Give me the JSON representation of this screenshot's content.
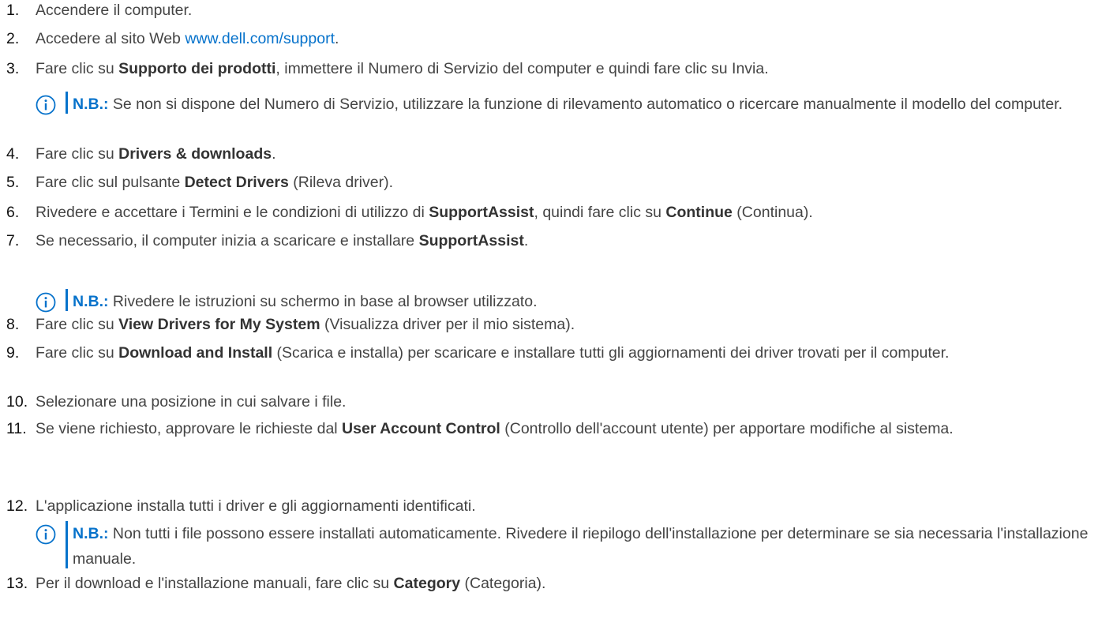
{
  "steps": [
    {
      "num": "1.",
      "parts": [
        {
          "t": "Accendere il computer."
        }
      ]
    },
    {
      "num": "2.",
      "parts": [
        {
          "t": "Accedere al sito Web "
        },
        {
          "t": "www.dell.com/support",
          "link": true
        },
        {
          "t": "."
        }
      ]
    },
    {
      "num": "3.",
      "parts": [
        {
          "t": "Fare clic su "
        },
        {
          "t": "Supporto dei prodotti",
          "b": true
        },
        {
          "t": ", immettere il Numero di Servizio del computer e quindi fare clic su Invia."
        }
      ]
    },
    {
      "num": "4.",
      "parts": [
        {
          "t": "Fare clic su "
        },
        {
          "t": "Drivers & downloads",
          "b": true
        },
        {
          "t": "."
        }
      ]
    },
    {
      "num": "5.",
      "parts": [
        {
          "t": "Fare clic sul pulsante "
        },
        {
          "t": "Detect Drivers",
          "b": true
        },
        {
          "t": " (Rileva driver)."
        }
      ]
    },
    {
      "num": "6.",
      "parts": [
        {
          "t": "Rivedere e accettare i Termini e le condizioni di utilizzo di "
        },
        {
          "t": "SupportAssist",
          "b": true
        },
        {
          "t": ", quindi fare clic su "
        },
        {
          "t": "Continue",
          "b": true
        },
        {
          "t": " (Continua)."
        }
      ]
    },
    {
      "num": "7.",
      "parts": [
        {
          "t": "Se necessario, il computer inizia a scaricare e installare "
        },
        {
          "t": "SupportAssist",
          "b": true
        },
        {
          "t": "."
        }
      ]
    },
    {
      "num": "8.",
      "parts": [
        {
          "t": "Fare clic su "
        },
        {
          "t": "View Drivers for My System",
          "b": true
        },
        {
          "t": " (Visualizza driver per il mio sistema)."
        }
      ]
    },
    {
      "num": "9.",
      "parts": [
        {
          "t": "Fare clic su "
        },
        {
          "t": "Download and Install",
          "b": true
        },
        {
          "t": " (Scarica e installa) per scaricare e installare tutti gli aggiornamenti dei driver trovati per il computer."
        }
      ]
    },
    {
      "num": "10.",
      "parts": [
        {
          "t": "Selezionare una posizione in cui salvare i file."
        }
      ]
    },
    {
      "num": "11.",
      "parts": [
        {
          "t": "Se viene richiesto, approvare le richieste dal "
        },
        {
          "t": "User Account Control",
          "b": true
        },
        {
          "t": " (Controllo dell'account utente) per apportare modifiche al sistema."
        }
      ]
    },
    {
      "num": "12.",
      "parts": [
        {
          "t": "L'applicazione installa tutti i driver e gli aggiornamenti identificati."
        }
      ]
    },
    {
      "num": "13.",
      "parts": [
        {
          "t": "Per il download e l'installazione manuali, fare clic su "
        },
        {
          "t": "Category",
          "b": true
        },
        {
          "t": " (Categoria)."
        }
      ]
    }
  ],
  "notes": [
    {
      "label": "N.B.:",
      "text": " Se non si dispone del Numero di Servizio, utilizzare la funzione di rilevamento automatico o ricercare manualmente il modello del computer."
    },
    {
      "label": "N.B.:",
      "text": " Rivedere le istruzioni su schermo in base al browser utilizzato."
    },
    {
      "label": "N.B.:",
      "text": " Non tutti i file possono essere installati automaticamente. Rivedere il riepilogo dell'installazione per determinare se sia necessaria l'installazione manuale."
    }
  ],
  "icon": "info-circle-icon",
  "colors": {
    "link": "#0672cb",
    "note_label": "#0672cb",
    "text": "#444444"
  }
}
